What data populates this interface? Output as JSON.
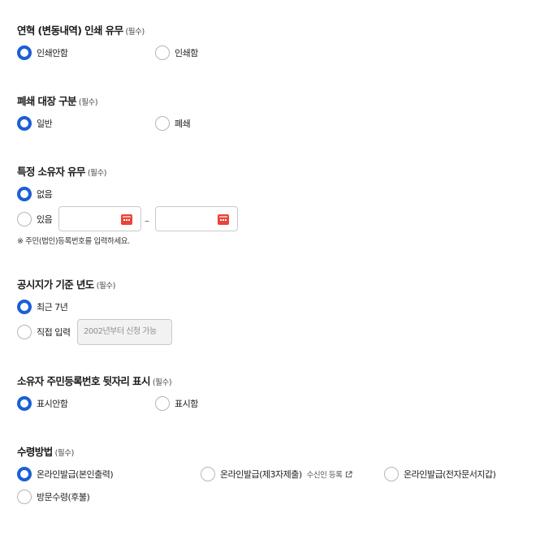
{
  "required_mark": "(필수)",
  "history_print": {
    "title": "연혁 (변동내역) 인쇄 유무",
    "options": [
      "인쇄안함",
      "인쇄함"
    ],
    "selected": 0
  },
  "closure_ledger": {
    "title": "폐쇄 대장 구분",
    "options": [
      "일반",
      "폐쇄"
    ],
    "selected": 0
  },
  "specific_owner": {
    "title": "특정 소유자 유무",
    "options": [
      "없음",
      "있음"
    ],
    "selected": 0,
    "note": "※ 주민(법인)등록번호를 입력하세요."
  },
  "base_year": {
    "title": "공시지가 기준 년도",
    "options": [
      "최근 7년",
      "직접 입력"
    ],
    "selected": 0,
    "input_placeholder": "2002년부터 신청 가능"
  },
  "owner_id_display": {
    "title": "소유자 주민등록번호 뒷자리 표시",
    "options": [
      "표시안함",
      "표시함"
    ],
    "selected": 0
  },
  "receive_method": {
    "title": "수령방법",
    "options": [
      "온라인발급(본인출력)",
      "온라인발급(제3자제출)",
      "온라인발급(전자문서지갑)",
      "방문수령(후불)"
    ],
    "selected": 0,
    "recipient_link": "수신인 등록"
  },
  "colors": {
    "accent": "#1a5fd6",
    "calendar": "#e8443a"
  }
}
